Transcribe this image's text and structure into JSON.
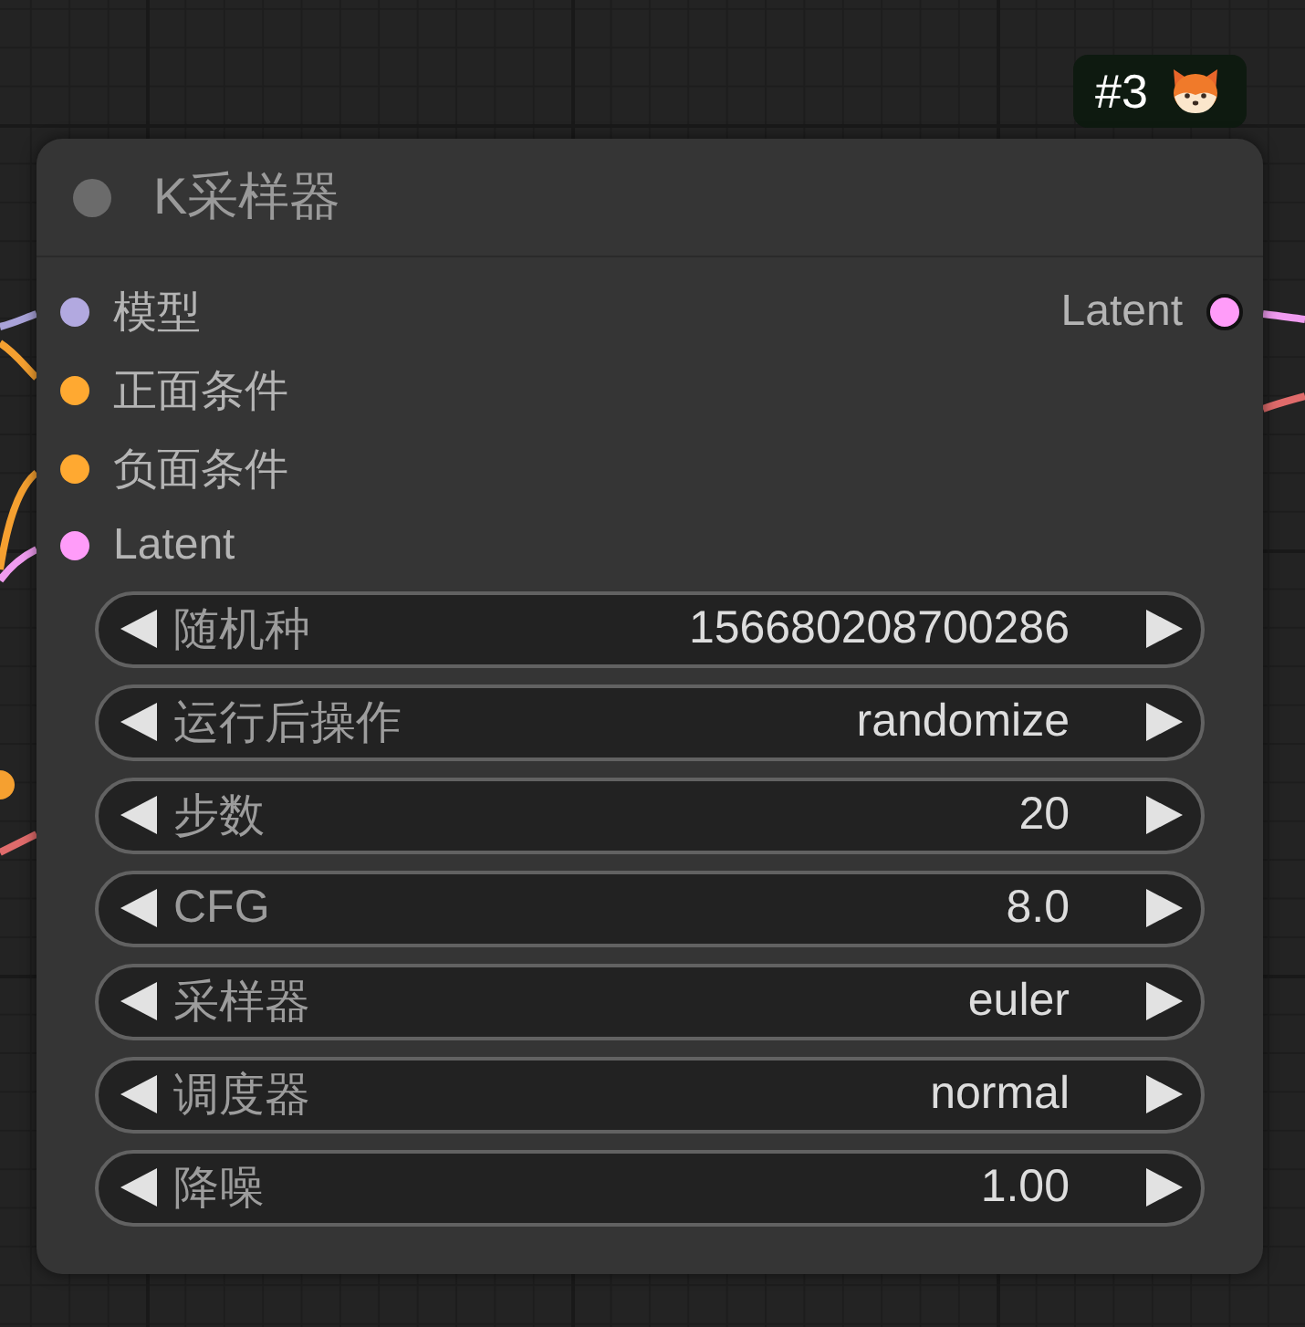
{
  "badge": {
    "text": "#3"
  },
  "node": {
    "title": "K采样器",
    "inputs": [
      {
        "label": "模型",
        "color": "#b2a9e0"
      },
      {
        "label": "正面条件",
        "color": "#ffa931"
      },
      {
        "label": "负面条件",
        "color": "#ffa931"
      },
      {
        "label": "Latent",
        "color": "#ff9cf9"
      }
    ],
    "outputs": [
      {
        "label": "Latent",
        "color": "#ff9cf9"
      }
    ],
    "widgets": [
      {
        "label": "随机种",
        "value": "156680208700286"
      },
      {
        "label": "运行后操作",
        "value": "randomize"
      },
      {
        "label": "步数",
        "value": "20"
      },
      {
        "label": "CFG",
        "value": "8.0"
      },
      {
        "label": "采样器",
        "value": "euler"
      },
      {
        "label": "调度器",
        "value": "normal"
      },
      {
        "label": "降噪",
        "value": "1.00"
      }
    ]
  }
}
